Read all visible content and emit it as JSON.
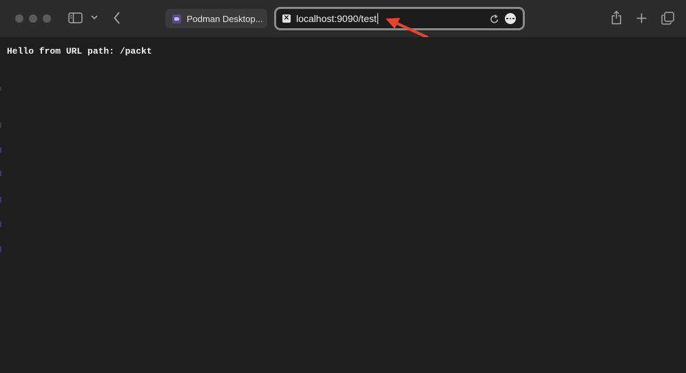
{
  "window": {
    "controls": [
      "close-icon",
      "minimize-icon",
      "zoom-icon"
    ]
  },
  "toolbar": {
    "sidebar_icon": "sidebar-icon",
    "chevron_icon": "chevron-down-icon",
    "back_icon": "back-arrow-icon",
    "share_icon": "share-icon",
    "new_tab_icon": "plus-icon",
    "tabs_overview_icon": "tabs-overview-icon"
  },
  "tab": {
    "title": "Podman Desktop...",
    "favicon": "podman-favicon"
  },
  "address_bar": {
    "url": "localhost:9090/test",
    "favicon": "page-favicon",
    "reload_icon": "reload-icon",
    "more_icon": "more-options-icon"
  },
  "page": {
    "body_text": "Hello from URL path: /packt"
  },
  "annotation": {
    "arrow_color": "#e8432e",
    "arrow_icon": "red-arrow-annotation"
  }
}
